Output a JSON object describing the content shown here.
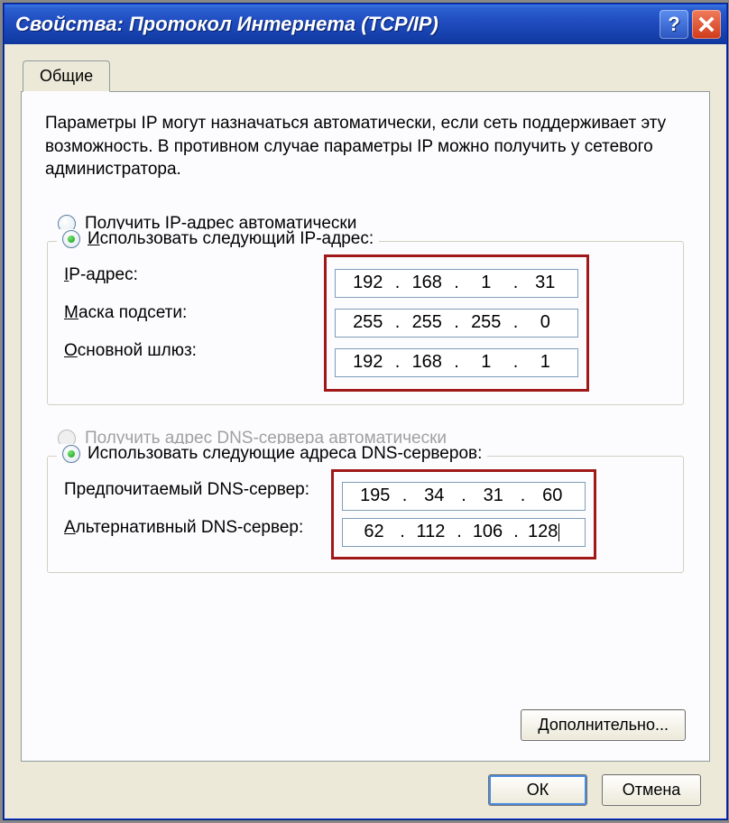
{
  "window": {
    "title": "Свойства: Протокол Интернета (TCP/IP)"
  },
  "tab": {
    "general": "Общие"
  },
  "intro": "Параметры IP могут назначаться автоматически, если сеть поддерживает эту возможность. В противном случае параметры IP можно получить у сетевого администратора.",
  "ip": {
    "auto_prefix": "П",
    "auto_rest": "олучить IP-адрес автоматически",
    "manual_prefix": "И",
    "manual_rest": "спользовать следующий IP-адрес:",
    "addr_label_prefix": "I",
    "addr_label_rest": "P-адрес:",
    "addr": {
      "o1": "192",
      "o2": "168",
      "o3": "1",
      "o4": "31"
    },
    "mask_label_prefix": "М",
    "mask_label_rest": "аска подсети:",
    "mask": {
      "o1": "255",
      "o2": "255",
      "o3": "255",
      "o4": "0"
    },
    "gw_label_prefix": "О",
    "gw_label_rest": "сновной шлюз:",
    "gw": {
      "o1": "192",
      "o2": "168",
      "o3": "1",
      "o4": "1"
    }
  },
  "dns": {
    "auto": "Получить адрес DNS-сервера автоматически",
    "manual": "Использовать следующие адреса DNS-серверов:",
    "pref_label": "Предпочитаемый DNS-сервер:",
    "alt_label_prefix": "А",
    "alt_label_rest": "льтернативный DNS-сервер:",
    "pref": {
      "o1": "195",
      "o2": "34",
      "o3": "31",
      "o4": "60"
    },
    "alt": {
      "o1": "62",
      "o2": "112",
      "o3": "106",
      "o4": "128"
    }
  },
  "buttons": {
    "advanced_prefix": "Д",
    "advanced_rest": "ополнительно...",
    "ok": "ОК",
    "cancel": "Отмена"
  }
}
